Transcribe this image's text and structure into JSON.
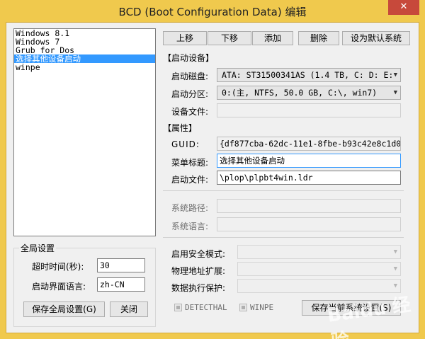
{
  "titlebar": {
    "title": "BCD (Boot Configuration Data) 编辑",
    "close_label": "✕"
  },
  "entries": [
    "Windows 8.1",
    "Windows 7",
    "Grub for Dos",
    "选择其他设备启动",
    "winpe"
  ],
  "selected_entry_index": 3,
  "global": {
    "group_title": "全局设置",
    "timeout_label": "超时时间(秒):",
    "timeout_value": "30",
    "language_label": "启动界面语言:",
    "language_value": "zh-CN",
    "save_global_label": "保存全局设置(G)",
    "close_label": "关闭"
  },
  "toolbar": {
    "up": "上移",
    "down": "下移",
    "add": "添加",
    "delete": "删除",
    "set_default": "设为默认系统"
  },
  "boot_device": {
    "section_title": "【启动设备】",
    "disk_label": "启动磁盘:",
    "disk_value": "ATA: ST31500341AS (1.4 TB, C: D: E:",
    "partition_label": "启动分区:",
    "partition_value": "0:(主,  NTFS,  50.0 GB, C:\\, win7)",
    "device_file_label": "设备文件:",
    "device_file_value": ""
  },
  "properties": {
    "section_title": "【属性】",
    "guid_label": "GUID:",
    "guid_value": "{df877cba-62dc-11e1-8fbe-b93c42e8c1d0}",
    "menu_title_label": "菜单标题:",
    "menu_title_value": "选择其他设备启动",
    "boot_file_label": "启动文件:",
    "boot_file_value": "\\plop\\plpbt4win.ldr",
    "system_path_label": "系统路径:",
    "system_path_value": "",
    "system_lang_label": "系统语言:",
    "system_lang_value": "",
    "safe_mode_label": "启用安全模式:",
    "pae_label": "物理地址扩展:",
    "dep_label": "数据执行保护:",
    "detecthal_label": "DETECTHAL",
    "winpe_label": "WINPE",
    "save_current_label": "保存当前系统设置(S)"
  },
  "colors": {
    "frame": "#f0c94d",
    "selection": "#3399ff",
    "close": "#c7493b"
  },
  "watermark": "Baidu 经验"
}
